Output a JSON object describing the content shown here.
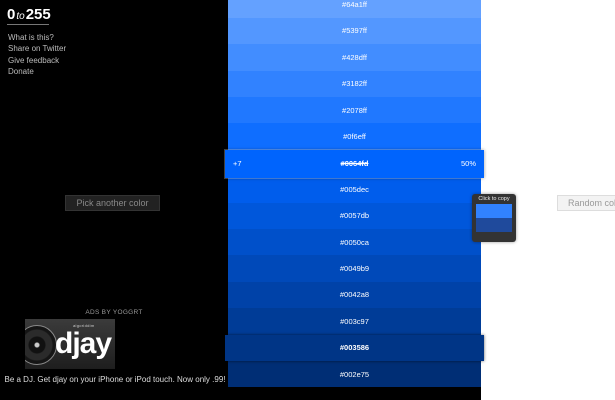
{
  "logo": {
    "zero": "0",
    "to": "to",
    "max": "255"
  },
  "nav": [
    {
      "label": "What is this?"
    },
    {
      "label": "Share on Twitter"
    },
    {
      "label": "Give feedback"
    },
    {
      "label": "Donate"
    }
  ],
  "pick_button": "Pick another color",
  "ads": {
    "label": "ADS BY YOGGRT",
    "brand": "djay",
    "tagline": "algoriddim",
    "text": "Be a DJ. Get djay on your iPhone or iPod touch. Now only .99!"
  },
  "swatches": [
    {
      "hex": "#64a1ff",
      "color": "#64a1ff"
    },
    {
      "hex": "#5397ff",
      "color": "#5397ff"
    },
    {
      "hex": "#428dff",
      "color": "#428dff"
    },
    {
      "hex": "#3182ff",
      "color": "#3182ff"
    },
    {
      "hex": "#2078ff",
      "color": "#2078ff"
    },
    {
      "hex": "#0f6eff",
      "color": "#0f6eff"
    },
    {
      "hex": "#0064fd",
      "color": "#0064fd",
      "selected": true,
      "step": "+7",
      "percent": "50%"
    },
    {
      "hex": "#005dec",
      "color": "#005dec"
    },
    {
      "hex": "#0057db",
      "color": "#0057db"
    },
    {
      "hex": "#0050ca",
      "color": "#0050ca"
    },
    {
      "hex": "#0049b9",
      "color": "#0049b9"
    },
    {
      "hex": "#0042a8",
      "color": "#0042a8"
    },
    {
      "hex": "#003c97",
      "color": "#003c97"
    },
    {
      "hex": "#003586",
      "color": "#003586",
      "bold": true
    },
    {
      "hex": "#002e75",
      "color": "#002e75"
    }
  ],
  "tooltip": {
    "label": "Click to copy"
  },
  "random_button": "Random color"
}
